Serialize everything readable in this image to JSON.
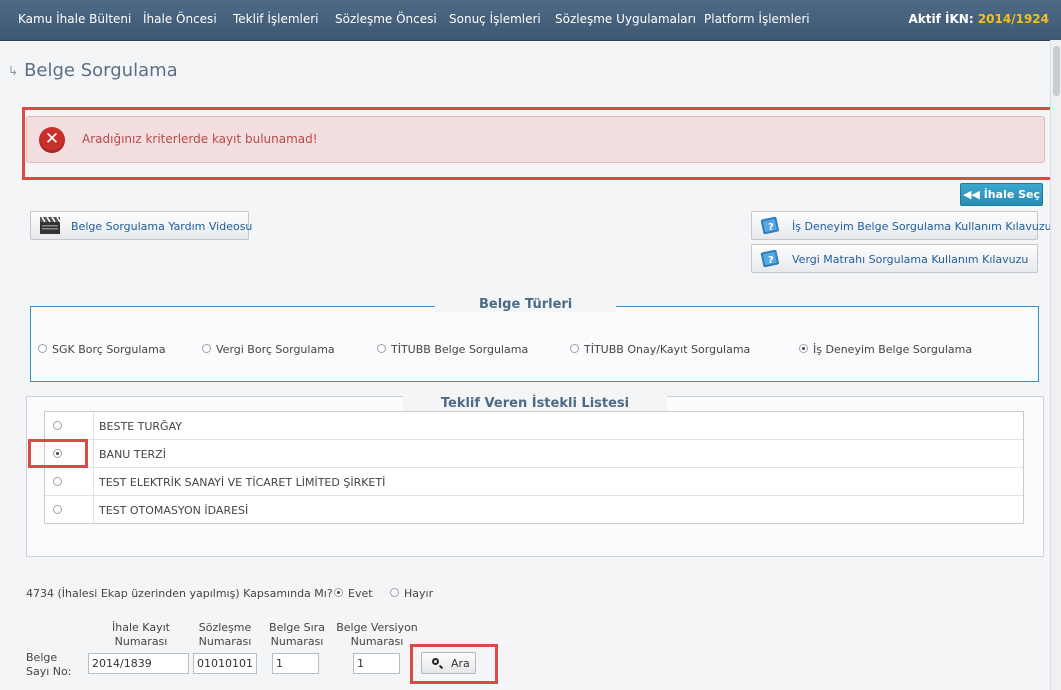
{
  "nav": {
    "items": [
      "Kamu İhale Bülteni",
      "İhale Öncesi",
      "Teklif İşlemleri",
      "Sözleşme Öncesi",
      "Sonuç İşlemleri",
      "Sözleşme Uygulamaları",
      "Platform İşlemleri"
    ],
    "aktif_ikn_label": "Aktif İKN:",
    "aktif_ikn_value": "2014/1924"
  },
  "page_title": "Belge Sorgulama",
  "alert": {
    "message": "Aradığınız kriterlerde kayıt bulunamad!",
    "icon": "error-icon",
    "color": "#b94a48"
  },
  "buttons": {
    "ihale_sec": "İhale Seç",
    "yardim_videosu": "Belge Sorgulama Yardım Videosu",
    "is_deneyim_kilavuz": "İş Deneyim Belge Sorgulama Kullanım Kılavuzu",
    "vergi_matrahi_kilavuz": "Vergi Matrahı Sorgulama Kullanım Kılavuzu",
    "ara": "Ara"
  },
  "belge_turleri": {
    "legend": "Belge Türleri",
    "options": [
      {
        "label": "SGK Borç Sorgulama",
        "selected": false
      },
      {
        "label": "Vergi Borç Sorgulama",
        "selected": false
      },
      {
        "label": "TİTUBB Belge Sorgulama",
        "selected": false
      },
      {
        "label": "TİTUBB Onay/Kayıt Sorgulama",
        "selected": false
      },
      {
        "label": "İş Deneyim Belge Sorgulama",
        "selected": true
      }
    ]
  },
  "istekli_listesi": {
    "legend": "Teklif Veren İstekli Listesi",
    "rows": [
      {
        "name": "BESTE TURĞAY",
        "selected": false
      },
      {
        "name": "BANU TERZİ",
        "selected": true
      },
      {
        "name": "TEST ELEKTRİK SANAYİ VE TİCARET LİMİTED ŞİRKETİ",
        "selected": false
      },
      {
        "name": "TEST OTOMASYON İDARESİ",
        "selected": false
      }
    ]
  },
  "kapsam": {
    "question": "4734 (İhalesi Ekap üzerinden yapılmış) Kapsamında Mı?",
    "evet": "Evet",
    "hayir": "Hayır",
    "selected": "Evet"
  },
  "belge_sayi": {
    "label": "Belge Sayı No:",
    "headers": [
      "İhale Kayıt Numarası",
      "Sözleşme Numarası",
      "Belge Sıra Numarası",
      "Belge Versiyon Numarası"
    ],
    "values": [
      "2014/1839",
      "01010101",
      "1",
      "1"
    ]
  },
  "colors": {
    "nav_bg": "#46617c",
    "accent_yellow": "#f3c11b",
    "highlight_red": "#d94b46",
    "primary_blue": "#2a8db2"
  }
}
